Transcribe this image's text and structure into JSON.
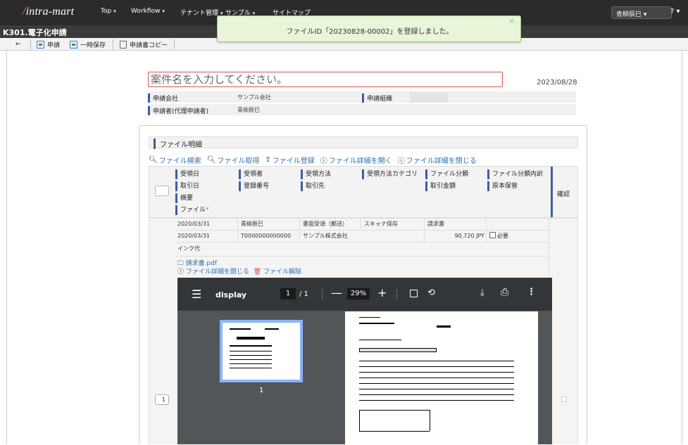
{
  "nav": {
    "logo": "intra-mart",
    "menus": [
      "Top",
      "Workflow",
      "テナント管理",
      "サンプル",
      "サイトマップ"
    ],
    "user": "青柳辰巳",
    "help": "?"
  },
  "page": {
    "title": "K301.電子化申請"
  },
  "toolbar": {
    "back": "←",
    "apply": "申請",
    "temp_save": "一時保存",
    "copy": "申請書コピー"
  },
  "toast": {
    "message": "ファイルID「20230828-00002」を登録しました。",
    "close": "×"
  },
  "form": {
    "case_placeholder": "案件名を入力してください。",
    "date": "2023/08/28",
    "company_label": "申請会社",
    "company_value": "サンプル会社",
    "org_label": "申請組織",
    "applicant_label": "申請者(代理申請者)",
    "applicant_value": "青柳辰巳"
  },
  "section": {
    "title": "ファイル明細",
    "actions": [
      "ファイル検索",
      "ファイル取得",
      "ファイル登録",
      "ファイル詳細を開く",
      "ファイル詳細を閉じる"
    ]
  },
  "grid_header": {
    "row1": [
      "受領日",
      "受領者",
      "受領方法",
      "受領方法カテゴリ",
      "ファイル分類",
      "ファイル分類内訳"
    ],
    "row2": [
      "取引日",
      "登録番号",
      "取引先",
      "取引金額",
      "原本保管"
    ],
    "summary": "摘要",
    "file": "ファイル",
    "required_mark": "*",
    "confirm": "確認"
  },
  "row": {
    "received_date": "2020/03/31",
    "receiver": "青柳辰巳",
    "method": "書面受領（郵送）",
    "method_category": "スキャナ保存",
    "file_class": "請求書",
    "trade_date": "2020/03/31",
    "reg_no": "T0000000000000",
    "partner": "サンプル株式会社",
    "amount": "90,720 JPY",
    "original_required": "必要",
    "summary": "インク代",
    "file_name": "請求書.pdf",
    "close_detail": "ファイル詳細を閉じる",
    "remove_file": "ファイル解除",
    "row_number": "1"
  },
  "pdf": {
    "name": "display",
    "page": "1",
    "total": "/ 1",
    "zoom": "29%",
    "thumb_label": "1"
  }
}
